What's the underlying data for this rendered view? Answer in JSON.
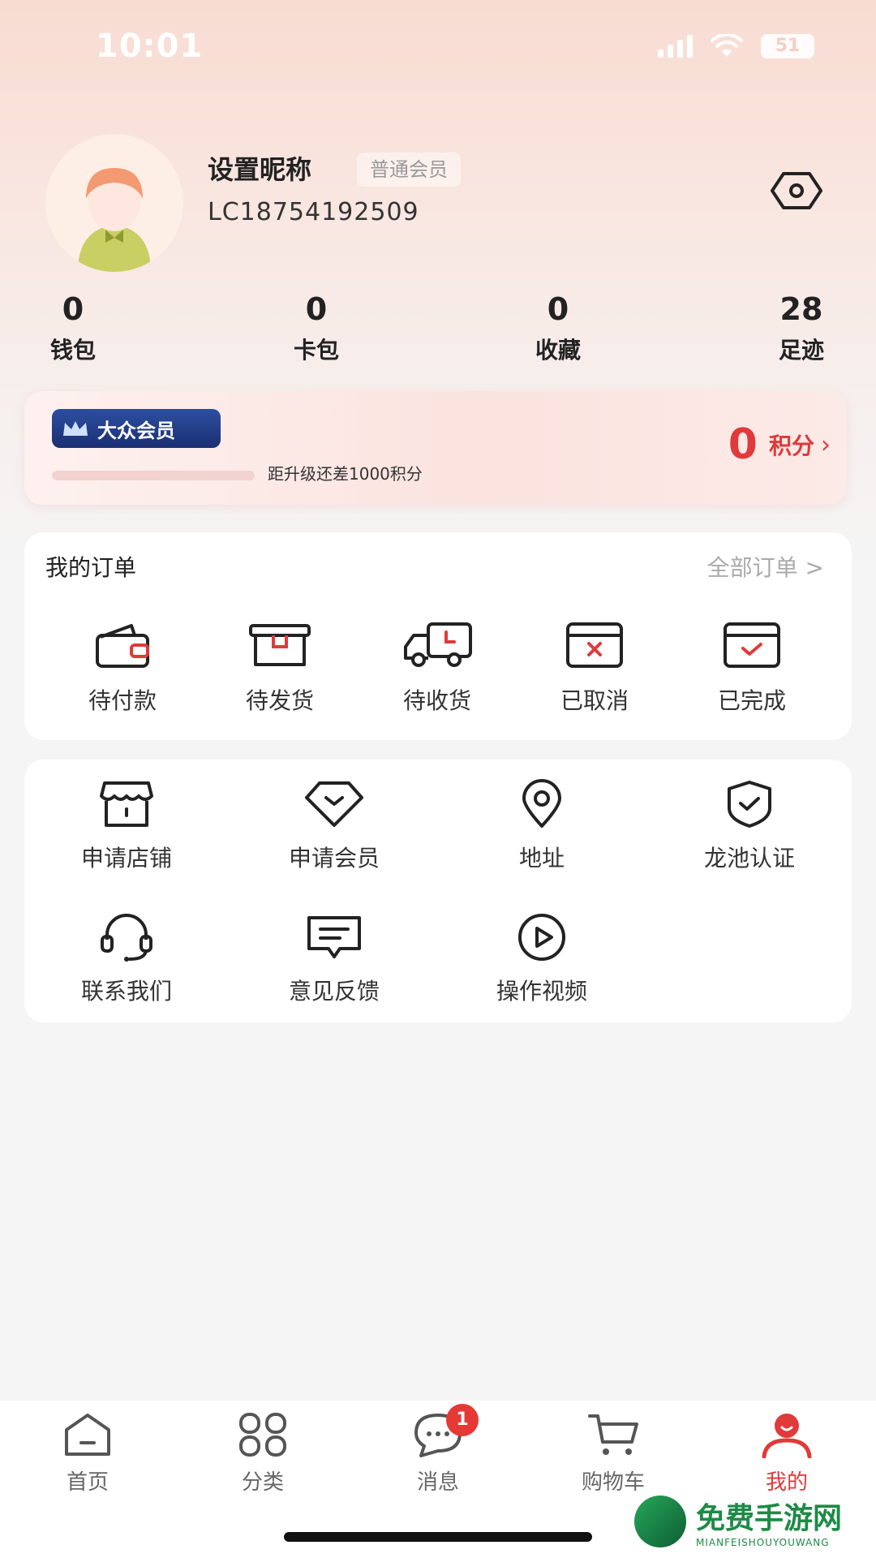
{
  "status_bar": {
    "time": "10:01",
    "battery": "51"
  },
  "profile": {
    "nickname": "设置昵称",
    "member_level": "普通会员",
    "user_id": "LC18754192509"
  },
  "stats": [
    {
      "value": "0",
      "label": "钱包"
    },
    {
      "value": "0",
      "label": "卡包"
    },
    {
      "value": "0",
      "label": "收藏"
    },
    {
      "value": "28",
      "label": "足迹"
    }
  ],
  "member_card": {
    "logo_text": "大众会员",
    "upgrade_tip": "距升级还差1000积分",
    "points_value": "0",
    "points_label": "积分",
    "progress": 0
  },
  "orders": {
    "title": "我的订单",
    "all_label": "全部订单 >",
    "items": [
      {
        "label": "待付款",
        "icon": "wallet-icon"
      },
      {
        "label": "待发货",
        "icon": "box-icon"
      },
      {
        "label": "待收货",
        "icon": "truck-icon"
      },
      {
        "label": "已取消",
        "icon": "cancelled-icon"
      },
      {
        "label": "已完成",
        "icon": "completed-icon"
      }
    ]
  },
  "services": {
    "items": [
      {
        "label": "申请店铺",
        "icon": "shop-icon"
      },
      {
        "label": "申请会员",
        "icon": "diamond-icon"
      },
      {
        "label": "地址",
        "icon": "location-icon"
      },
      {
        "label": "龙池认证",
        "icon": "shield-check-icon"
      },
      {
        "label": "联系我们",
        "icon": "headset-icon"
      },
      {
        "label": "意见反馈",
        "icon": "feedback-icon"
      },
      {
        "label": "操作视频",
        "icon": "play-icon"
      }
    ]
  },
  "tabbar": {
    "items": [
      {
        "label": "首页",
        "icon": "home-icon"
      },
      {
        "label": "分类",
        "icon": "category-icon"
      },
      {
        "label": "消息",
        "icon": "message-icon",
        "badge": "1"
      },
      {
        "label": "购物车",
        "icon": "cart-icon"
      },
      {
        "label": "我的",
        "icon": "profile-icon",
        "active": true
      }
    ]
  },
  "watermark": {
    "title": "免费手游网",
    "subtitle": "MIANFEISHOUYOUWANG"
  },
  "colors": {
    "accent": "#e03a3a",
    "background": "#f5f5f5",
    "badge": "#e53935"
  }
}
